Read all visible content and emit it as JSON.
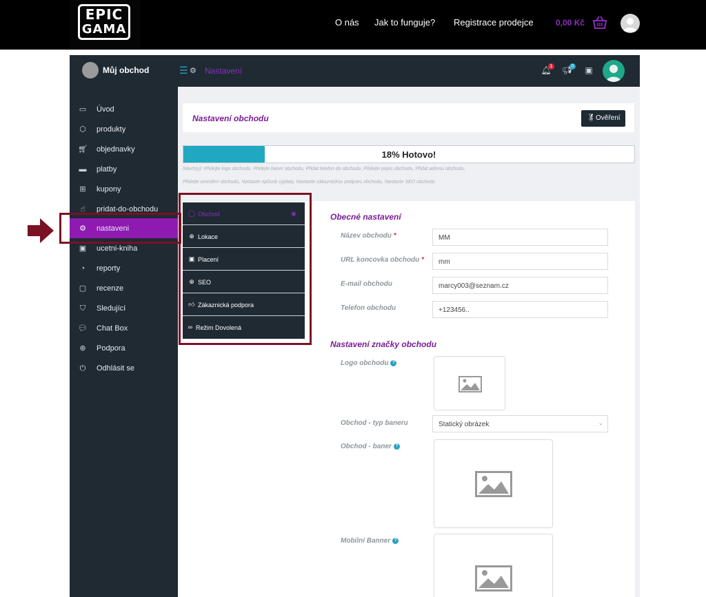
{
  "site": {
    "logo_line1": "EPIC",
    "logo_line2": "GAMA",
    "nav": [
      "O nás",
      "Jak to funguje?",
      "Registrace prodejce"
    ],
    "cart_total": "0,00 Kč"
  },
  "header": {
    "store_name": "Můj obchod",
    "breadcrumb": "Nastavení",
    "notifications_count": "1",
    "announcements_count": "0"
  },
  "sidebar": {
    "items": [
      {
        "label": "Úvod",
        "icon": "monitor-icon"
      },
      {
        "label": "produkty",
        "icon": "box-icon"
      },
      {
        "label": "objednavky",
        "icon": "cart-icon"
      },
      {
        "label": "platby",
        "icon": "credit-card-icon"
      },
      {
        "label": "kupony",
        "icon": "gift-icon"
      },
      {
        "label": "pridat-do-obchodu",
        "icon": "hand-pointer-icon"
      },
      {
        "label": "nastaveni",
        "icon": "gears-icon"
      },
      {
        "label": "ucetni-kniha",
        "icon": "money-bill-icon"
      },
      {
        "label": "reporty",
        "icon": "pie-chart-icon"
      },
      {
        "label": "recenze",
        "icon": "comment-icon"
      },
      {
        "label": "Sledující",
        "icon": "shirt-icon"
      },
      {
        "label": "Chat Box",
        "icon": "chat-icon"
      },
      {
        "label": "Podpora",
        "icon": "globe-icon"
      },
      {
        "label": "Odhlásit se",
        "icon": "power-icon"
      }
    ],
    "active_index": 6
  },
  "page": {
    "title": "Nastavení obchodu",
    "verify_button": "Ověření",
    "progress_percent": 18,
    "progress_label": "18% Hotovo!",
    "hint_line1": "Návrh(y): Přidejte logo obchodu, Přidejte baner obchodu, Přidat telefon do obchodu, Přidejte popis obchodu, Přidat adresu obchodu,",
    "hint_line2": "Přidejte umístění obchodu, Nastavte způsob výplaty, Nastavte zákaznickou podporu obchodu, Nastavte SEO obchodu"
  },
  "settings_menu": {
    "items": [
      {
        "label": "Obchod",
        "icon": "store-icon"
      },
      {
        "label": "Lokace",
        "icon": "globe-icon"
      },
      {
        "label": "Placení",
        "icon": "money-bill-icon"
      },
      {
        "label": "SEO",
        "icon": "globe-icon"
      },
      {
        "label": "Zákaznická podpora",
        "icon": "thumbs-up-icon"
      },
      {
        "label": "Režim Dovolená",
        "icon": "glasses-icon"
      }
    ],
    "active_index": 0
  },
  "form": {
    "general_title": "Obecné nastavení",
    "store_name_label": "Název obchodu",
    "store_name_value": "MM",
    "url_label": "URL koncovka obchodu",
    "url_value": "mm",
    "email_label": "E-mail obchodu",
    "email_value": "marcy003@seznam.cz",
    "phone_label": "Telefon obchodu",
    "phone_value": "+123456..",
    "brand_title": "Nastavení značky obchodu",
    "logo_label": "Logo obchodu",
    "banner_type_label": "Obchod - typ baneru",
    "banner_type_value": "Statický obrázek",
    "banner_label": "Obchod - baner",
    "mobile_banner_label": "Mobilní Banner"
  },
  "colors": {
    "accent": "#8e1ab2",
    "dark": "#1f2a33",
    "progress": "#20a8c2",
    "highlight": "#7b1124"
  }
}
